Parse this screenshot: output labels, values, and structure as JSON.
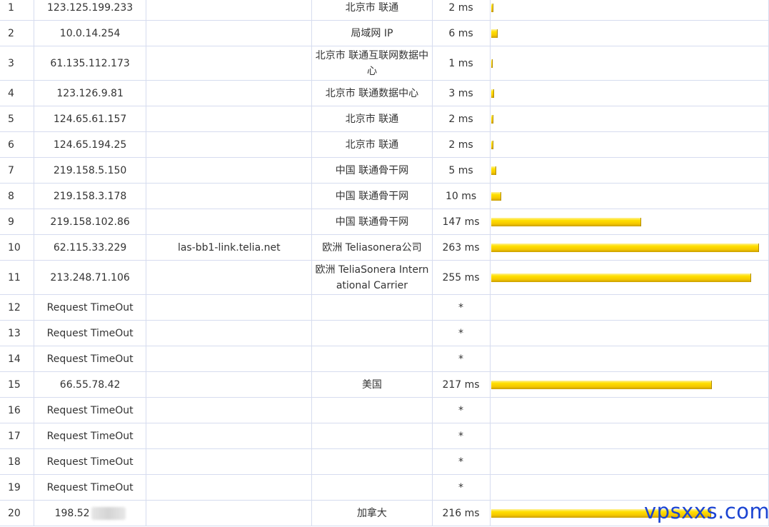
{
  "bar_max_ms": 263,
  "bar_color": "#f5c800",
  "watermark": "vpsxxs.com",
  "hops": [
    {
      "hop": "1",
      "ip": "123.125.199.233",
      "host": "",
      "location": "北京市 联通",
      "time": "2 ms",
      "ms": 2
    },
    {
      "hop": "2",
      "ip": "10.0.14.254",
      "host": "",
      "location": "局域网 IP",
      "time": "6 ms",
      "ms": 6
    },
    {
      "hop": "3",
      "ip": "61.135.112.173",
      "host": "",
      "location": "北京市 联通互联网数据中心",
      "time": "1 ms",
      "ms": 1
    },
    {
      "hop": "4",
      "ip": "123.126.9.81",
      "host": "",
      "location": "北京市 联通数据中心",
      "time": "3 ms",
      "ms": 3
    },
    {
      "hop": "5",
      "ip": "124.65.61.157",
      "host": "",
      "location": "北京市 联通",
      "time": "2 ms",
      "ms": 2
    },
    {
      "hop": "6",
      "ip": "124.65.194.25",
      "host": "",
      "location": "北京市 联通",
      "time": "2 ms",
      "ms": 2
    },
    {
      "hop": "7",
      "ip": "219.158.5.150",
      "host": "",
      "location": "中国 联通骨干网",
      "time": "5 ms",
      "ms": 5
    },
    {
      "hop": "8",
      "ip": "219.158.3.178",
      "host": "",
      "location": "中国 联通骨干网",
      "time": "10 ms",
      "ms": 10
    },
    {
      "hop": "9",
      "ip": "219.158.102.86",
      "host": "",
      "location": "中国 联通骨干网",
      "time": "147 ms",
      "ms": 147
    },
    {
      "hop": "10",
      "ip": "62.115.33.229",
      "host": "las-bb1-link.telia.net",
      "location": "欧洲 Teliasonera公司",
      "time": "263 ms",
      "ms": 263
    },
    {
      "hop": "11",
      "ip": "213.248.71.106",
      "host": "",
      "location": "欧洲 TeliaSonera International Carrier",
      "time": "255 ms",
      "ms": 255
    },
    {
      "hop": "12",
      "ip": "Request TimeOut",
      "host": "",
      "location": "",
      "time": "*",
      "ms": null
    },
    {
      "hop": "13",
      "ip": "Request TimeOut",
      "host": "",
      "location": "",
      "time": "*",
      "ms": null
    },
    {
      "hop": "14",
      "ip": "Request TimeOut",
      "host": "",
      "location": "",
      "time": "*",
      "ms": null
    },
    {
      "hop": "15",
      "ip": "66.55.78.42",
      "host": "",
      "location": "美国",
      "time": "217 ms",
      "ms": 217
    },
    {
      "hop": "16",
      "ip": "Request TimeOut",
      "host": "",
      "location": "",
      "time": "*",
      "ms": null
    },
    {
      "hop": "17",
      "ip": "Request TimeOut",
      "host": "",
      "location": "",
      "time": "*",
      "ms": null
    },
    {
      "hop": "18",
      "ip": "Request TimeOut",
      "host": "",
      "location": "",
      "time": "*",
      "ms": null
    },
    {
      "hop": "19",
      "ip": "Request TimeOut",
      "host": "",
      "location": "",
      "time": "*",
      "ms": null
    },
    {
      "hop": "20",
      "ip": "198.52",
      "host": "",
      "location": "加拿大",
      "time": "216 ms",
      "ms": 216,
      "ip_redacted": true
    }
  ]
}
